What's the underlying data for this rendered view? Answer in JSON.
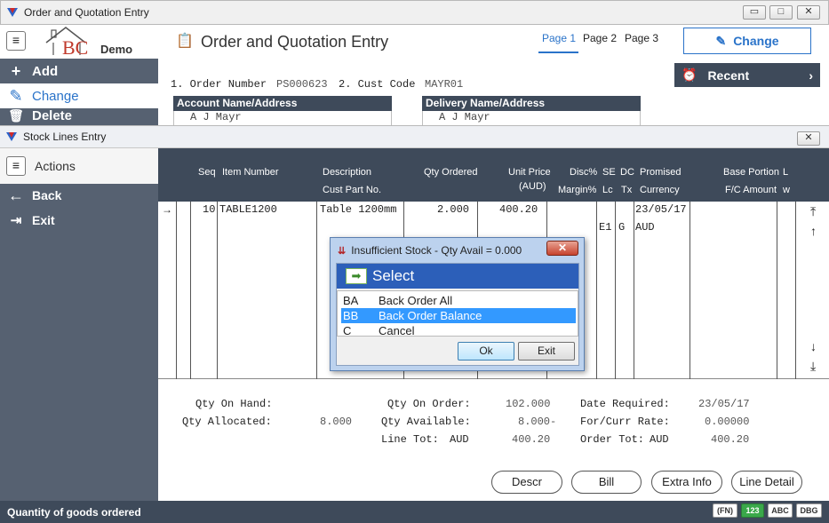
{
  "window": {
    "title": "Order and Quotation Entry"
  },
  "header": {
    "logo_text": "BC",
    "logo_sub": "Demo",
    "title": "Order and Quotation Entry",
    "pages": [
      "Page 1",
      "Page 2",
      "Page 3"
    ],
    "change_button": "Change",
    "recent_label": "Recent"
  },
  "menu": {
    "add": "Add",
    "change": "Change",
    "delete": "Delete"
  },
  "order": {
    "order_label": "1. Order Number",
    "order_value": "PS000623",
    "cust_label": "2. Cust Code",
    "cust_value": "MAYR01",
    "account_hdr": "Account Name/Address",
    "account_name": "A J Mayr",
    "delivery_hdr": "Delivery Name/Address",
    "delivery_name": "A J Mayr"
  },
  "stock": {
    "title": "Stock Lines Entry",
    "actions": "Actions",
    "back": "Back",
    "exit": "Exit",
    "columns": {
      "seq": "Seq",
      "item": "Item Number",
      "desc": "Description",
      "cust_part": "Cust Part No.",
      "qty": "Qty Ordered",
      "price": "Unit Price",
      "price_unit": "(AUD)",
      "disc": "Disc%",
      "margin": "Margin%",
      "se": "SE",
      "lc": "Lc",
      "dc": "DC",
      "tx": "Tx",
      "promised": "Promised",
      "currency": "Currency",
      "base": "Base Portion",
      "fc": "F/C Amount",
      "extra1": "L",
      "extra2": "w"
    },
    "row": {
      "seq": "10",
      "item": "TABLE1200",
      "desc": "Table 1200mm",
      "qty": "2.000",
      "price": "400.20",
      "date": "23/05/17",
      "se": "E1",
      "dc": "G",
      "currency": "AUD"
    }
  },
  "stats": {
    "qoh_label": "Qty On Hand:",
    "qalloc_label": "Qty Allocated:",
    "qalloc_value": "8.000",
    "qorder_label": "Qty On Order:",
    "qorder_value": "102.000",
    "qavail_label": "Qty Available:",
    "qavail_value": "8.000-",
    "linetot_label": "Line Tot:",
    "linetot_cur": "AUD",
    "linetot_value": "400.20",
    "datereq_label": "Date Required:",
    "datereq_value": "23/05/17",
    "rate_label": "For/Curr Rate:",
    "rate_value": "0.00000",
    "ordertot_label": "Order Tot:",
    "ordertot_cur": "AUD",
    "ordertot_value": "400.20"
  },
  "buttons": {
    "descr": "Descr",
    "bill": "Bill",
    "extra": "Extra Info",
    "line": "Line Detail"
  },
  "status": {
    "text": "Quantity of goods ordered",
    "fn": "(FN)",
    "num": "123",
    "abc": "ABC",
    "dbg": "DBG"
  },
  "dialog": {
    "title": "Insufficient Stock - Qty Avail = 0.000",
    "header": "Select",
    "options": [
      {
        "key": "BA",
        "label": "Back Order All"
      },
      {
        "key": "BB",
        "label": "Back Order Balance"
      },
      {
        "key": "C",
        "label": "Cancel"
      }
    ],
    "ok": "Ok",
    "exit": "Exit"
  },
  "colors": {
    "sidebar": "#566171",
    "dark": "#3e4a5a",
    "accent": "#2a73c9",
    "select_blue": "#3399ff"
  }
}
